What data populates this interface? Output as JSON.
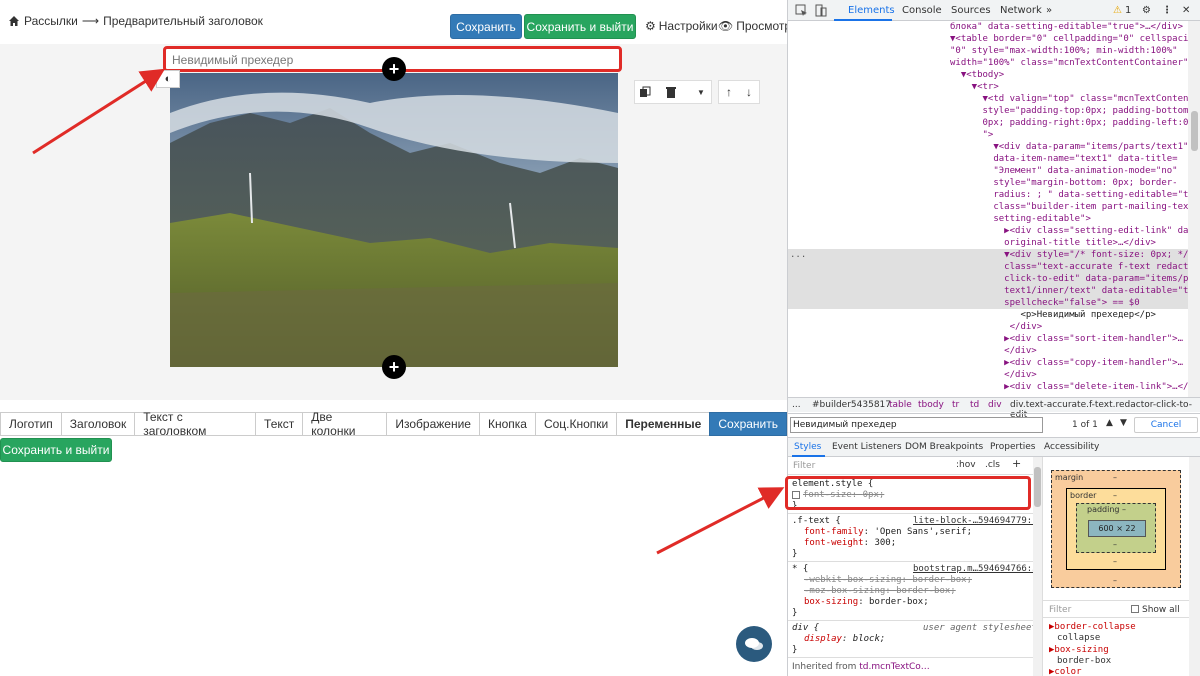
{
  "editor": {
    "breadcrumb": {
      "parent": "Рассылки",
      "arrow": "⟶",
      "current": "Предварительный заголовок"
    },
    "buttons": {
      "save": "Сохранить",
      "save_exit": "Сохранить и выйти",
      "settings": "Настройки",
      "preview": "Просмотр"
    },
    "preheader_text": "Невидимый прехедер",
    "blocks": [
      {
        "label": "Логотип",
        "style": "normal"
      },
      {
        "label": "Заголовок",
        "style": "normal"
      },
      {
        "label": "Текст с заголовком",
        "style": "normal"
      },
      {
        "label": "Текст",
        "style": "normal"
      },
      {
        "label": "Две колонки",
        "style": "normal"
      },
      {
        "label": "Изображение",
        "style": "normal"
      },
      {
        "label": "Кнопка",
        "style": "normal"
      },
      {
        "label": "Соц.Кнопки",
        "style": "normal"
      },
      {
        "label": "Переменные",
        "style": "bold"
      },
      {
        "label": "Сохранить",
        "style": "save"
      }
    ],
    "bottom_save_exit": "Сохранить и выйти",
    "colors": {
      "accent_red": "#e02b27",
      "blue": "#337ab7",
      "green": "#28a55f"
    }
  },
  "devtools": {
    "tabs": [
      "Elements",
      "Console",
      "Sources",
      "Network"
    ],
    "active_tab": "Elements",
    "warning_count": "1",
    "dom_lines": [
      "блока\" data-setting-editable=\"true\">…</div>",
      "▼<table border=\"0\" cellpadding=\"0\" cellspacing=",
      "\"0\" style=\"max-width:100%; min-width:100%\"",
      "width=\"100%\" class=\"mcnTextContentContainer\">",
      "  ▼<tbody>",
      "    ▼<tr>",
      "      ▼<td valign=\"top\" class=\"mcnTextContent\"",
      "      style=\"padding-top:0px; padding-bottom:",
      "      0px; padding-right:0px; padding-left:0px;",
      "      \">",
      "        ▼<div data-param=\"items/parts/text1\"",
      "        data-item-name=\"text1\" data-title=",
      "        \"Элемент\" data-animation-mode=\"no\"",
      "        style=\"margin-bottom: 0px; border-",
      "        radius: ; \" data-setting-editable=\"true\"",
      "        class=\"builder-item part-mailing-text",
      "        setting-editable\">",
      "          ▶<div class=\"setting-edit-link\" data-",
      "          original-title title>…</div>",
      "          ▼<div style=\"/* font-size: 0px; */\"",
      "          class=\"text-accurate f-text redactor-",
      "          click-to-edit\" data-param=\"items/parts/",
      "          text1/inner/text\" data-editable=\"true\"",
      "          spellcheck=\"false\"> == $0",
      "             <p>Невидимый прехедер</p>",
      "           </div>",
      "          ▶<div class=\"sort-item-handler\">…",
      "          </div>",
      "          ▶<div class=\"copy-item-handler\">…",
      "          </div>",
      "          ▶<div class=\"delete-item-link\">…</div>"
    ],
    "dom_ellipsis": "...",
    "crumbs": [
      "...",
      "#builder5435817",
      "table",
      "tbody",
      "tr",
      "td",
      "div",
      "div.text-accurate.f-text.redactor-click-to-edit"
    ],
    "search_value": "Невидимый прехедер",
    "search_count": "1 of 1",
    "cancel_label": "Cancel",
    "style_tabs": [
      "Styles",
      "Event Listeners",
      "DOM Breakpoints",
      "Properties",
      "Accessibility"
    ],
    "filter_placeholder": "Filter",
    "hov": ":hov",
    "cls": ".cls",
    "rules": {
      "element_style": {
        "selector": "element.style {",
        "prop": "font-size",
        "value": "0px;",
        "close": "}"
      },
      "f_text": {
        "selector": ".f-text {",
        "source": "lite-block-…594694779:1",
        "props": [
          [
            "font-family",
            "'Open Sans',serif;"
          ],
          [
            "font-weight",
            "300;"
          ]
        ],
        "close": "}"
      },
      "star": {
        "selector": "* {",
        "source": "bootstrap.m…594694766:5",
        "props": [
          [
            "-webkit-box-sizing",
            "border-box;"
          ],
          [
            "-moz-box-sizing",
            "border-box;"
          ],
          [
            "box-sizing",
            "border-box;"
          ]
        ],
        "close": "}"
      },
      "div_ua": {
        "selector": "div {",
        "source": "user agent stylesheet",
        "prop": "display",
        "value": "block;",
        "close": "}"
      },
      "inherited": {
        "label": "Inherited from",
        "target": "td.mcnTextCo…"
      }
    },
    "box_model": {
      "margin": "margin",
      "border": "border",
      "padding": "padding",
      "dash": "–",
      "content": "600 × 22"
    },
    "computed": {
      "filter": "Filter",
      "show_all": "Show all",
      "items": [
        {
          "prop": "border-collapse",
          "value": "collapse"
        },
        {
          "prop": "box-sizing",
          "value": "border-box"
        },
        {
          "prop": "color",
          "value": ""
        }
      ]
    }
  }
}
